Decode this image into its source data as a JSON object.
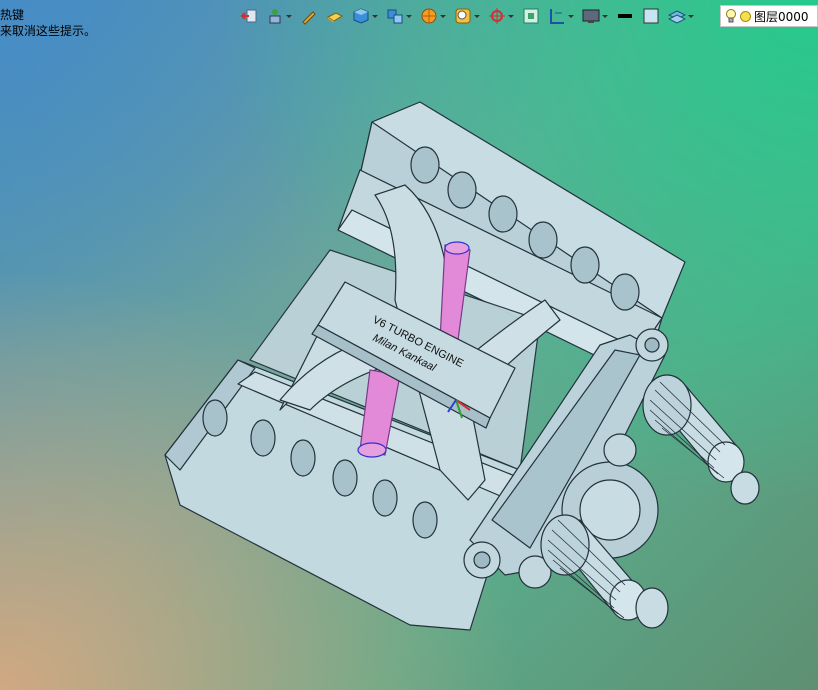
{
  "hint": {
    "line1": "热键",
    "line2": "来取消这些提示。"
  },
  "toolbar": {
    "icons": [
      "back-arrow-icon",
      "move-icon",
      "pencil-icon",
      "block-icon",
      "cube-icon",
      "split-cube-icon",
      "sun-view-icon",
      "zoom-view-icon",
      "rotate-icon",
      "fit-view-icon",
      "frame-icon",
      "display-icon",
      "line-color-icon",
      "face-color-icon",
      "layer-stack-icon"
    ]
  },
  "layer": {
    "name": "图层0000"
  },
  "model": {
    "plate_line1": "V6 TURBO ENGINE",
    "plate_line2": "Milan Kankaal"
  },
  "colors": {
    "body": "#c8dce3",
    "edge": "#23323a",
    "highlight": "#e28ad8"
  }
}
